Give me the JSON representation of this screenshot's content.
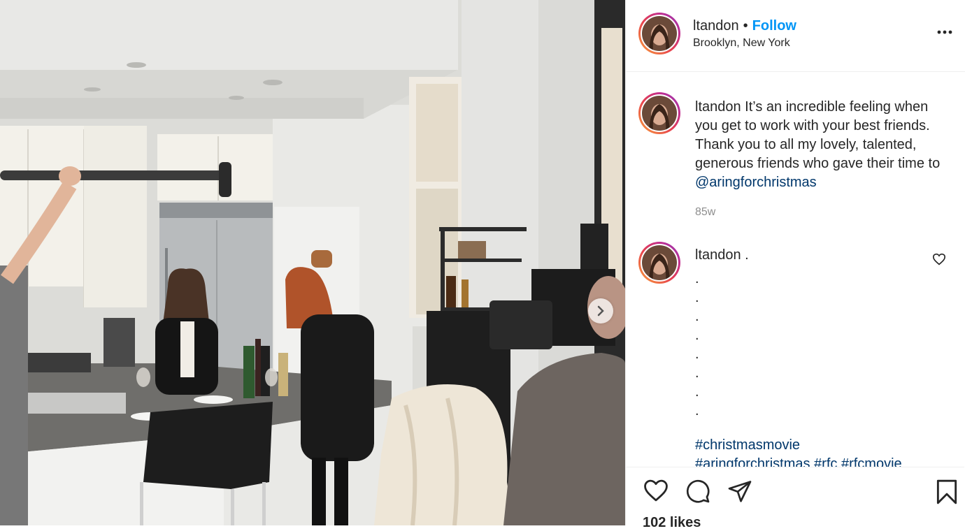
{
  "post": {
    "username": "ltandon",
    "separator": "•",
    "follow_label": "Follow",
    "location": "Brooklyn, New York",
    "more_icon": "more-options-icon",
    "next_icon": "chevron-right-icon"
  },
  "caption": {
    "username": "ltandon",
    "text_before_mention": " It’s an incredible feeling when you get to work with your best friends. Thank you to all my lovely, talented, generous friends who gave their time to ",
    "mention": "@aringforchristmas",
    "time": "85w"
  },
  "comment": {
    "username": "ltandon",
    "text": " .",
    "dots": [
      ".",
      ".",
      ".",
      ".",
      ".",
      ".",
      ".",
      "."
    ],
    "tags_line1": "#christmasmovie",
    "tags_line2": "#aringforchristmas #rfc #rfcmovie"
  },
  "actions": {
    "icons": [
      "like-icon",
      "comment-icon",
      "share-icon",
      "save-icon"
    ],
    "likes": "102 likes"
  },
  "colors": {
    "accent": "#0095f6",
    "mention": "#00376b",
    "muted": "#8e8e8e",
    "text": "#262626"
  }
}
